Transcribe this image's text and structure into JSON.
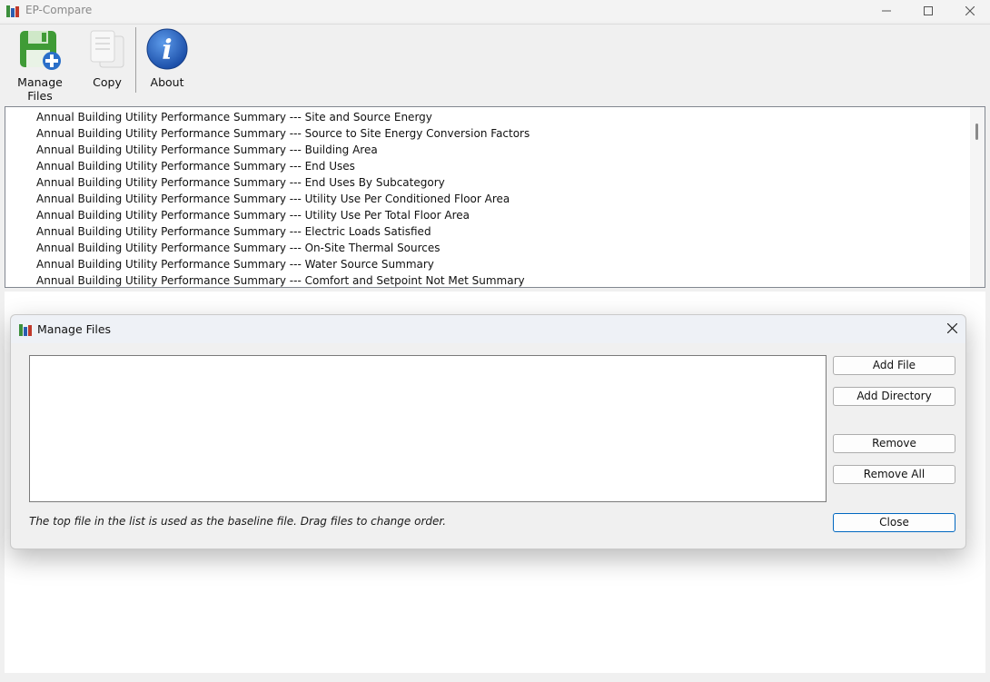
{
  "app": {
    "title": "EP-Compare",
    "window_controls": [
      "minimize-icon",
      "maximize-icon",
      "close-icon"
    ]
  },
  "toolbar": {
    "manage_files_label": "Manage Files",
    "copy_label": "Copy",
    "about_label": "About"
  },
  "report_list": {
    "items": [
      "Annual Building Utility Performance Summary --- Site and Source Energy",
      "Annual Building Utility Performance Summary --- Source to Site Energy Conversion Factors",
      "Annual Building Utility Performance Summary --- Building Area",
      "Annual Building Utility Performance Summary --- End Uses",
      "Annual Building Utility Performance Summary --- End Uses By Subcategory",
      "Annual Building Utility Performance Summary --- Utility Use Per Conditioned Floor Area",
      "Annual Building Utility Performance Summary --- Utility Use Per Total Floor Area",
      "Annual Building Utility Performance Summary --- Electric Loads Satisfied",
      "Annual Building Utility Performance Summary --- On-Site Thermal Sources",
      "Annual Building Utility Performance Summary --- Water Source Summary",
      "Annual Building Utility Performance Summary --- Comfort and Setpoint Not Met Summary"
    ]
  },
  "dialog": {
    "title": "Manage Files",
    "add_file_label": "Add File",
    "add_directory_label": "Add Directory",
    "remove_label": "Remove",
    "remove_all_label": "Remove All",
    "close_label": "Close",
    "hint": "The top file in the list is used as the baseline file. Drag files to change order."
  },
  "colors": {
    "accent": "#0067c0",
    "app_icon_green": "#3c8f3c",
    "app_icon_blue": "#2a5db0",
    "app_icon_red": "#c0392b"
  }
}
